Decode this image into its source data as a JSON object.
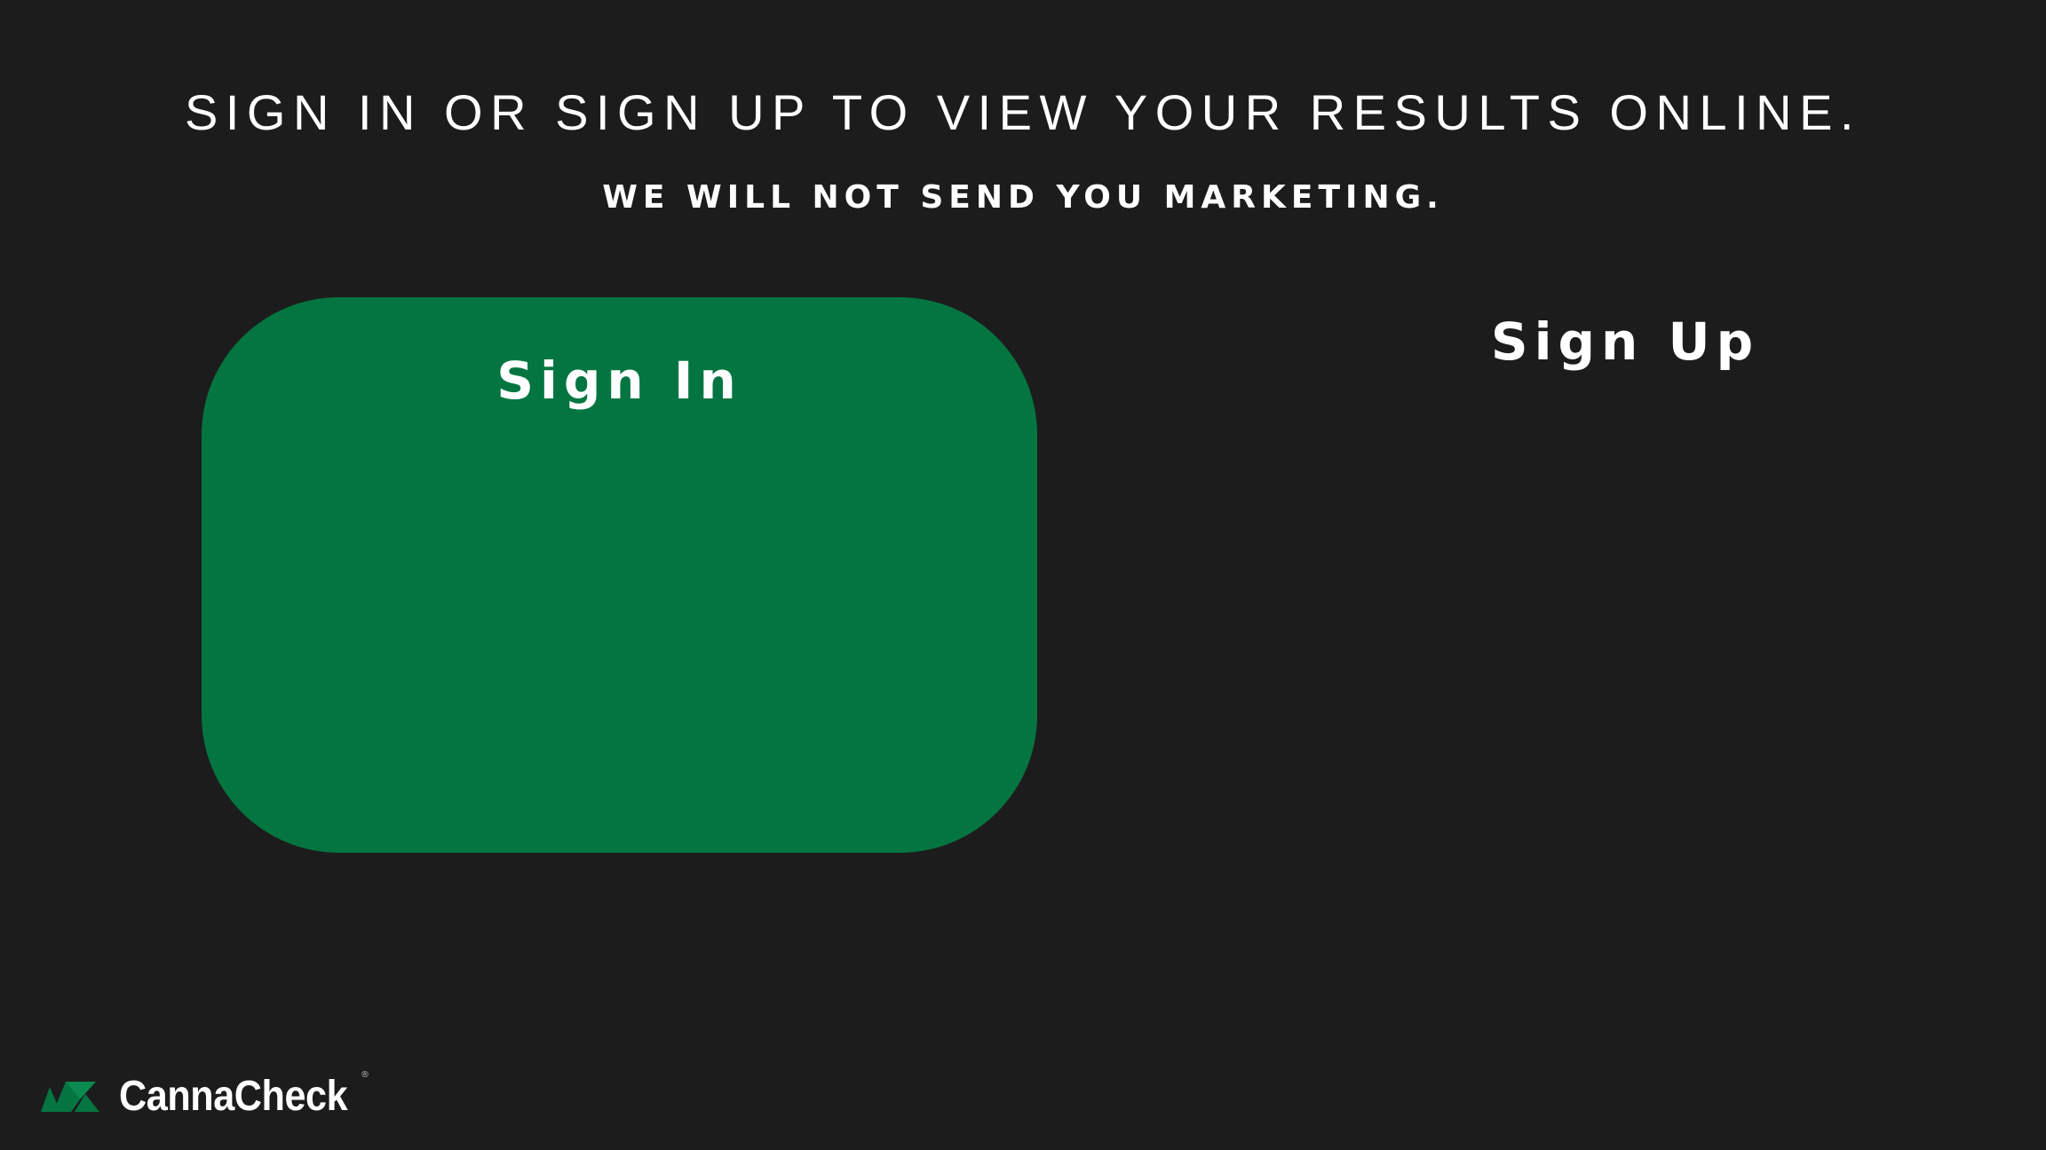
{
  "header": {
    "headline": "SIGN IN OR SIGN UP TO VIEW YOUR RESULTS ONLINE.",
    "subheadline": "WE WILL NOT SEND YOU MARKETING."
  },
  "actions": {
    "sign_in_label": "Sign In",
    "sign_up_label": "Sign Up"
  },
  "brand": {
    "name": "CannaCheck",
    "registered_mark": "®",
    "logo_icon": "leaf-logo-icon",
    "primary_color": "#047541",
    "background_color": "#1c1c1c",
    "text_color": "#ffffff"
  }
}
